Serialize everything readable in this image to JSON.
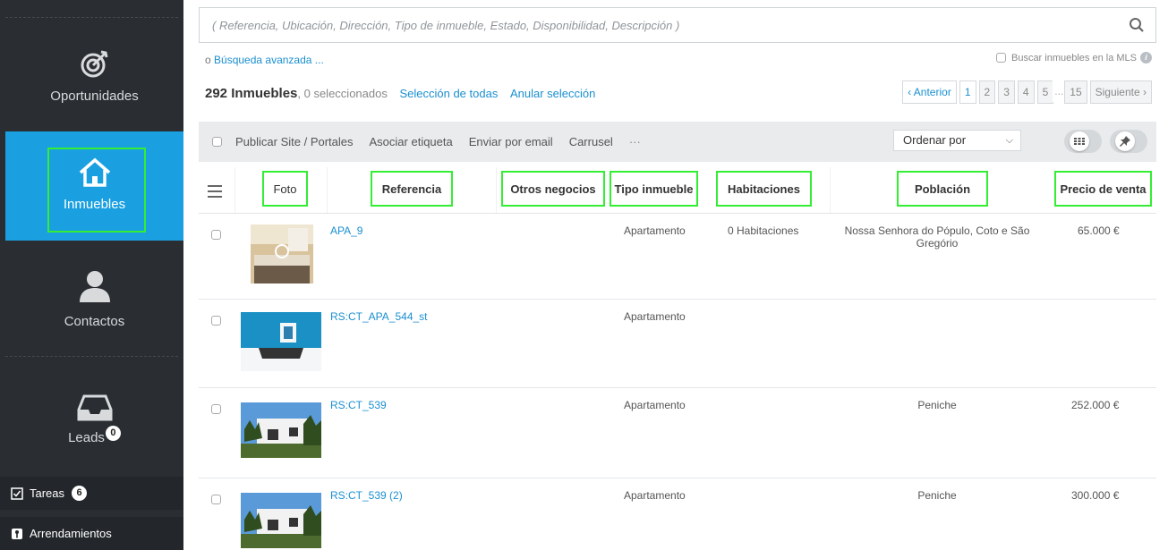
{
  "sidebar": {
    "items": [
      {
        "label": "Oportunidades",
        "icon": "target-icon"
      },
      {
        "label": "Inmuebles",
        "icon": "house-icon"
      },
      {
        "label": "Contactos",
        "icon": "user-icon"
      },
      {
        "label": "Leads",
        "icon": "inbox-icon",
        "badge": "0"
      }
    ],
    "footer": [
      {
        "label": "Tareas",
        "icon": "checkbox-icon",
        "badge": "6"
      },
      {
        "label": "Arrendamientos",
        "icon": "key-icon"
      }
    ]
  },
  "search": {
    "placeholder": "( Referencia, Ubicación, Dirección, Tipo de inmueble, Estado, Disponibilidad, Descripción )",
    "advanced_prefix": "o",
    "advanced_link": "Búsqueda avanzada ...",
    "mls_label": "Buscar inmuebles en la MLS"
  },
  "summary": {
    "count": "292 Inmuebles",
    "selected": ", 0 seleccionados",
    "select_all": "Selección de todas",
    "clear": "Anular selección"
  },
  "pager": {
    "prev": "‹ Anterior",
    "pages": [
      "1",
      "2",
      "3",
      "4",
      "5"
    ],
    "ellipsis": "...",
    "last": "15",
    "next": "Siguiente ›"
  },
  "toolbar": {
    "publish": "Publicar Site / Portales",
    "tag": "Asociar etiqueta",
    "email": "Enviar por email",
    "carousel": "Carrusel",
    "more": "···",
    "sort_label": "Ordenar por"
  },
  "table": {
    "columns": [
      "Foto",
      "Referencia",
      "Otros negocios",
      "Tipo inmueble",
      "Habitaciones",
      "Población",
      "Precio de venta"
    ],
    "rows": [
      {
        "ref": "APA_9",
        "tipo": "Apartamento",
        "habitaciones": "0 Habitaciones",
        "poblacion": "Nossa Senhora do Pópulo, Coto e São Gregório",
        "precio": "65.000 €"
      },
      {
        "ref": "RS:CT_APA_544_st",
        "tipo": "Apartamento",
        "habitaciones": "",
        "poblacion": "",
        "precio": ""
      },
      {
        "ref": "RS:CT_539",
        "tipo": "Apartamento",
        "habitaciones": "",
        "poblacion": "Peniche",
        "precio": "252.000 €"
      },
      {
        "ref": "RS:CT_539 (2)",
        "tipo": "Apartamento",
        "habitaciones": "",
        "poblacion": "Peniche",
        "precio": "300.000 €"
      }
    ]
  },
  "colors": {
    "sidebar": "#2a2e33",
    "active": "#1aa0e0",
    "link": "#1a8fd0",
    "highlight": "#33ee33"
  }
}
